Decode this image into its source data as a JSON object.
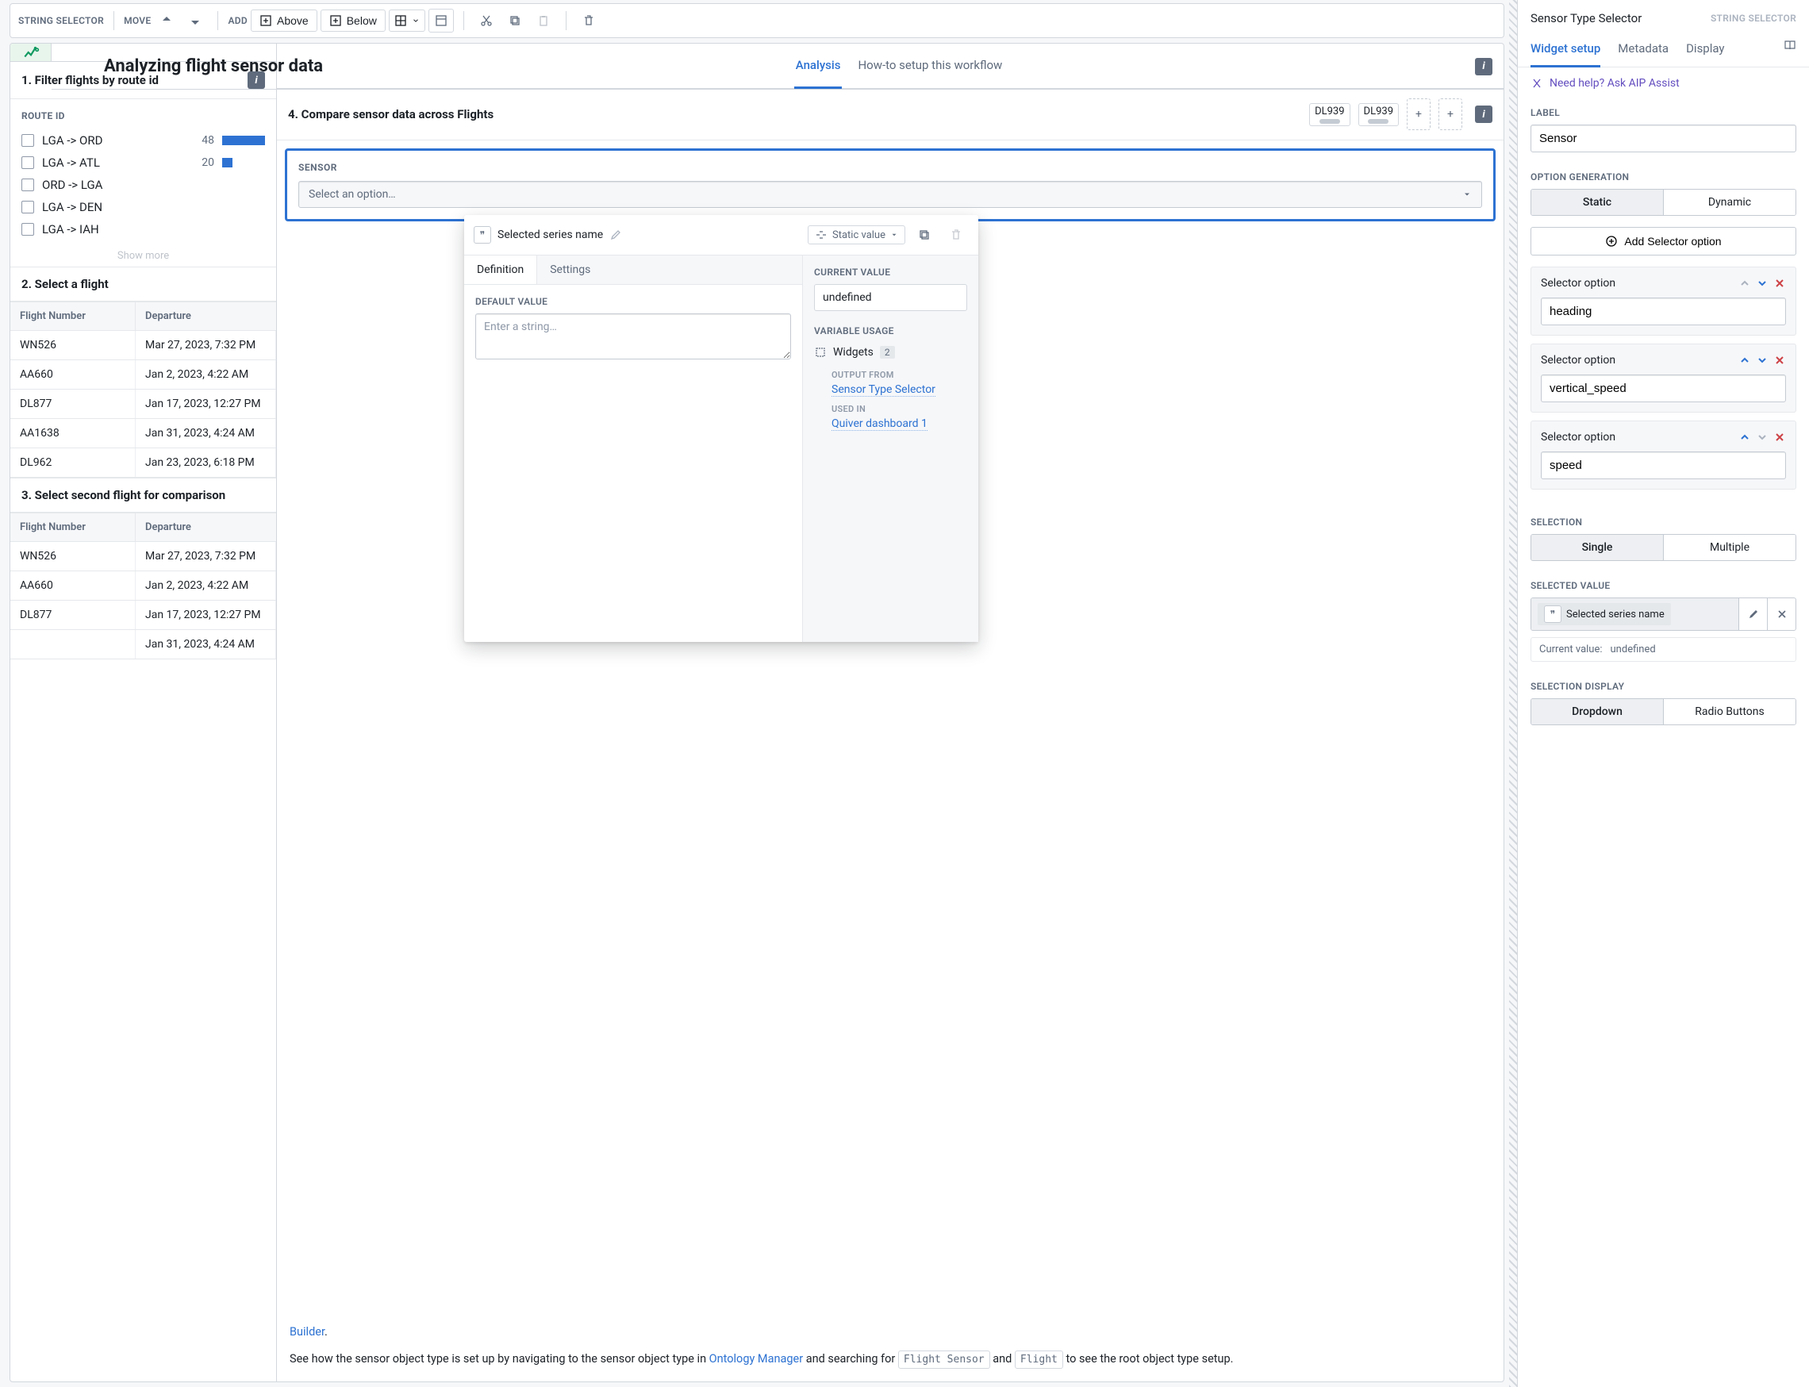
{
  "toolbar": {
    "selector_label": "STRING SELECTOR",
    "move_label": "MOVE",
    "add_label": "ADD",
    "above": "Above",
    "below": "Below"
  },
  "page": {
    "title": "Analyzing flight sensor data",
    "tab_analysis": "Analysis",
    "tab_howto": "How-to setup this workflow"
  },
  "section1": {
    "title": "1. Filter flights by route id",
    "filter_label": "ROUTE ID",
    "show_more": "Show more",
    "routes": [
      {
        "name": "LGA -> ORD",
        "count": 48,
        "pct": 100
      },
      {
        "name": "LGA -> ATL",
        "count": 20,
        "pct": 24
      },
      {
        "name": "ORD -> LGA",
        "count": "",
        "pct": 0
      },
      {
        "name": "LGA -> DEN",
        "count": "",
        "pct": 0
      },
      {
        "name": "LGA -> IAH",
        "count": "",
        "pct": 0
      }
    ]
  },
  "section2": {
    "title": "2. Select a flight",
    "col_flight": "Flight Number",
    "col_departure": "Departure",
    "rows": [
      {
        "flight": "WN526",
        "dep": "Mar 27, 2023, 7:32 PM"
      },
      {
        "flight": "AA660",
        "dep": "Jan 2, 2023, 4:22 AM"
      },
      {
        "flight": "DL877",
        "dep": "Jan 17, 2023, 12:27 PM"
      },
      {
        "flight": "AA1638",
        "dep": "Jan 31, 2023, 4:24 AM"
      },
      {
        "flight": "DL962",
        "dep": "Jan 23, 2023, 6:18 PM"
      }
    ]
  },
  "section3": {
    "title": "3. Select second flight for comparison",
    "col_flight": "Flight Number",
    "col_departure": "Departure",
    "rows": [
      {
        "flight": "WN526",
        "dep": "Mar 27, 2023, 7:32 PM"
      },
      {
        "flight": "AA660",
        "dep": "Jan 2, 2023, 4:22 AM"
      },
      {
        "flight": "DL877",
        "dep": "Jan 17, 2023, 12:27 PM"
      },
      {
        "flight": "",
        "dep": "Jan 31, 2023, 4:24 AM"
      }
    ]
  },
  "section4": {
    "title": "4. Compare sensor data across Flights",
    "chip1": "DL939",
    "chip2": "DL939",
    "sensor_label": "SENSOR",
    "select_placeholder": "Select an option…"
  },
  "popup": {
    "title": "Selected series name",
    "static_value": "Static value",
    "tab_def": "Definition",
    "tab_settings": "Settings",
    "default_label": "DEFAULT VALUE",
    "default_placeholder": "Enter a string…",
    "current_label": "CURRENT VALUE",
    "current_value": "undefined",
    "usage_label": "VARIABLE USAGE",
    "widgets": "Widgets",
    "widgets_count": "2",
    "output_from": "OUTPUT FROM",
    "output_link": "Sensor Type Selector",
    "used_in": "USED IN",
    "used_link": "Quiver dashboard 1"
  },
  "bottom": {
    "line1a": "Builder",
    "line1b": ".",
    "line2a": "See how the sensor object type is set up by navigating to the sensor object type in ",
    "line2b": "Ontology Manager",
    "line2c": " and searching for ",
    "code1": "Flight Sensor",
    "line2d": " and ",
    "code2": "Flight",
    "line2e": " to see the root object type setup."
  },
  "right": {
    "title": "Sensor Type Selector",
    "subtitle": "STRING SELECTOR",
    "tab_setup": "Widget setup",
    "tab_meta": "Metadata",
    "tab_display": "Display",
    "help": "Need help? Ask AIP Assist",
    "label_label": "LABEL",
    "label_value": "Sensor",
    "opt_gen_label": "OPTION GENERATION",
    "static": "Static",
    "dynamic": "Dynamic",
    "add_option": "Add Selector option",
    "option_title": "Selector option",
    "options": [
      {
        "value": "heading"
      },
      {
        "value": "vertical_speed"
      },
      {
        "value": "speed"
      }
    ],
    "selection_label": "SELECTION",
    "single": "Single",
    "multiple": "Multiple",
    "selected_value_label": "SELECTED VALUE",
    "selected_chip": "Selected series name",
    "cur_label": "Current value:",
    "cur_value": "undefined",
    "selection_display_label": "SELECTION DISPLAY",
    "dropdown": "Dropdown",
    "radio": "Radio Buttons"
  }
}
